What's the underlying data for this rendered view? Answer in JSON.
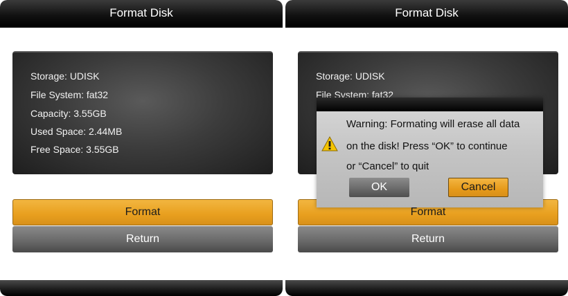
{
  "left_screen": {
    "title": "Format Disk",
    "info": {
      "storage": "Storage: UDISK",
      "file_system": "File System: fat32",
      "capacity": "Capacity: 3.55GB",
      "used_space": "Used Space: 2.44MB",
      "free_space": "Free Space: 3.55GB"
    },
    "format_label": "Format",
    "return_label": "Return"
  },
  "right_screen": {
    "title": "Format Disk",
    "info": {
      "storage": "Storage: UDISK",
      "file_system": "File System: fat32"
    },
    "format_label": "Format",
    "return_label": "Return",
    "dialog": {
      "message_line1": "Warning: Formating will erase all data",
      "message_line2": "on the disk! Press “OK” to continue",
      "message_line3": "or “Cancel” to quit",
      "ok_label": "OK",
      "cancel_label": "Cancel",
      "icon": "warning-triangle-icon"
    }
  },
  "colors": {
    "accent_orange": "#e89f1e",
    "bar_black": "#000000",
    "panel_dark": "#3c3c3c",
    "button_gray": "#6a6a6a",
    "warning_yellow": "#f5c400"
  }
}
